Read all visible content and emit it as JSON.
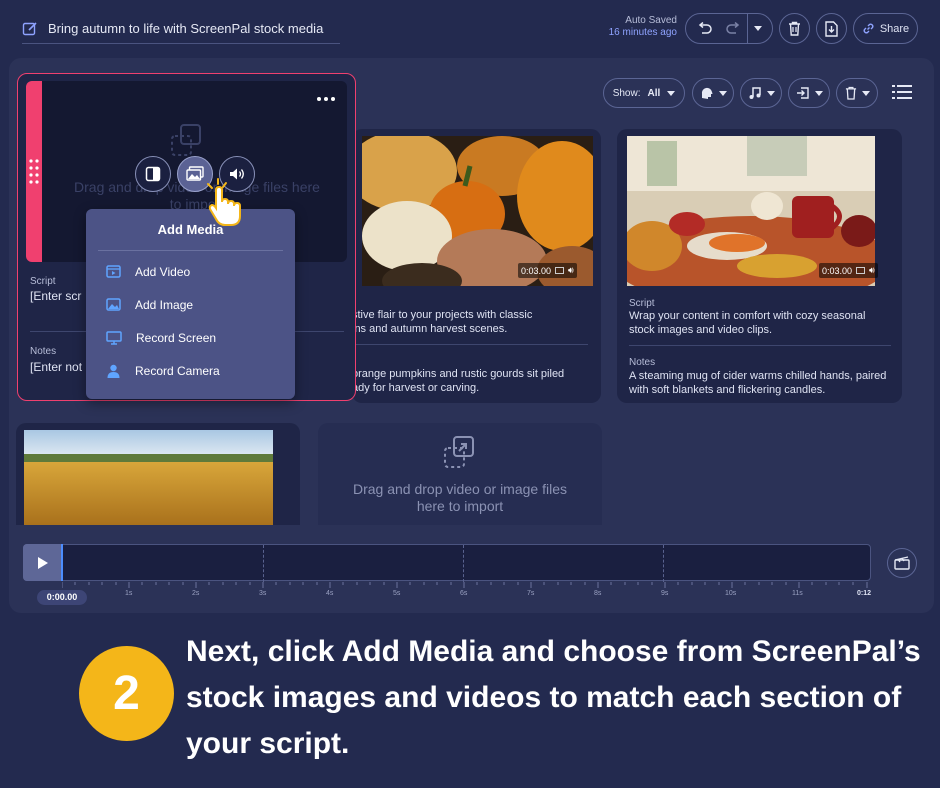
{
  "header": {
    "project_title": "Bring autumn to life with ScreenPal stock media",
    "autosave_label": "Auto Saved",
    "autosave_time": "16 minutes ago",
    "share_label": "Share"
  },
  "toolbar": {
    "show_label": "Show:",
    "show_value": "All"
  },
  "cards": [
    {
      "script_label": "Script",
      "script_text": "[Enter scr",
      "notes_label": "Notes",
      "notes_text": "[Enter not",
      "dropzone_text": "Drag and drop video or image files here to import"
    },
    {
      "duration": "0:03.00",
      "script_text": "stive flair to your projects with classic\nins and autumn harvest scenes.",
      "notes_text": "orange pumpkins and rustic gourds sit piled\nady for harvest or carving."
    },
    {
      "duration": "0:03.00",
      "script_label": "Script",
      "script_text": "Wrap your content in comfort with cozy seasonal stock images and video clips.",
      "notes_label": "Notes",
      "notes_text": "A steaming mug of cider warms chilled hands, paired with soft blankets and flickering candles."
    },
    {
      "dropzone_text": "Drag and drop video or image files here to import"
    }
  ],
  "add_media_menu": {
    "title": "Add Media",
    "items": [
      {
        "label": "Add Video",
        "icon": "video-icon"
      },
      {
        "label": "Add Image",
        "icon": "image-icon"
      },
      {
        "label": "Record Screen",
        "icon": "monitor-icon"
      },
      {
        "label": "Record Camera",
        "icon": "person-icon"
      }
    ]
  },
  "timeline": {
    "current_time": "0:00.00",
    "ticks": [
      "1s",
      "2s",
      "3s",
      "4s",
      "5s",
      "6s",
      "7s",
      "8s",
      "9s",
      "10s",
      "11s"
    ],
    "end_time": "0:12"
  },
  "caption": {
    "step_number": "2",
    "text": "Next, click Add Media and choose from ScreenPal’s stock images and videos to match each section of your script."
  },
  "colors": {
    "accent_pink": "#f0406f",
    "step_badge": "#f4b619",
    "link_blue": "#8fa3ff"
  }
}
